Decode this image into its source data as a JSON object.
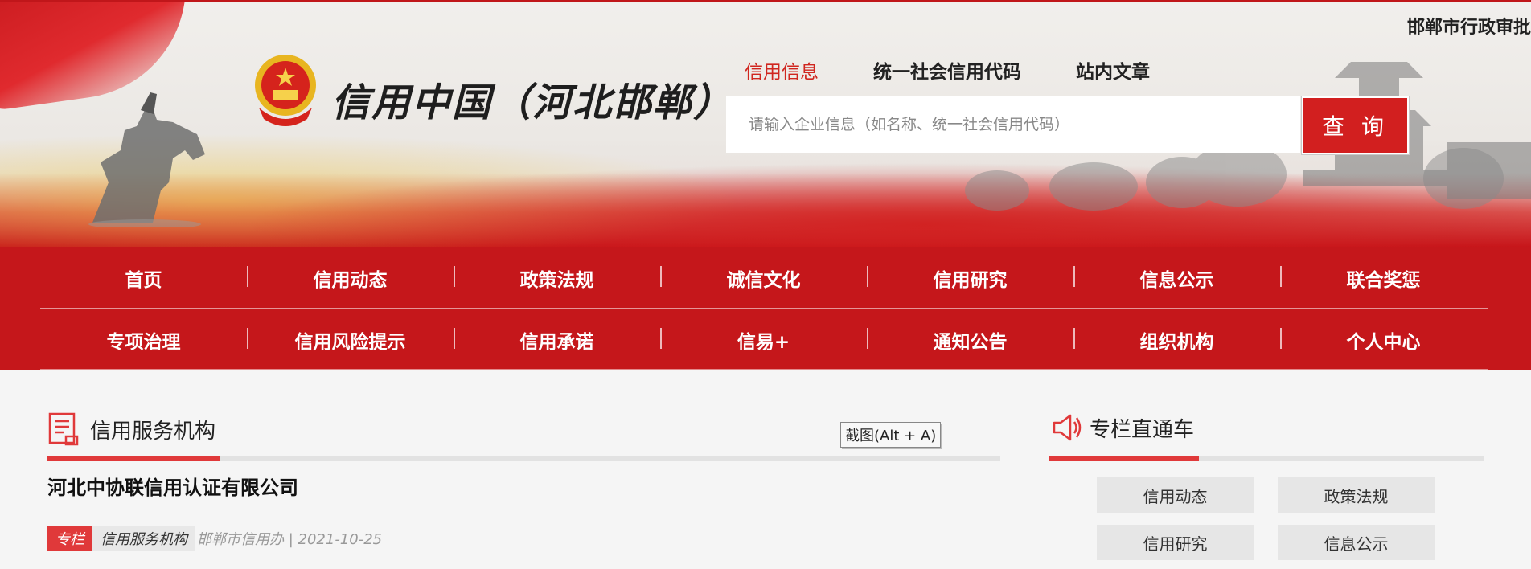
{
  "header": {
    "site_title": "信用中国（河北邯郸）",
    "city_label": "邯郸市行政审批",
    "emblem_icon": "national-emblem-icon"
  },
  "search": {
    "tabs": [
      {
        "label": "信用信息",
        "active": true
      },
      {
        "label": "统一社会信用代码",
        "active": false
      },
      {
        "label": "站内文章",
        "active": false
      }
    ],
    "placeholder": "请输入企业信息（如名称、统一社会信用代码）",
    "value": "",
    "button_label": "查 询"
  },
  "nav": {
    "row1": [
      "首页",
      "信用动态",
      "政策法规",
      "诚信文化",
      "信用研究",
      "信息公示",
      "联合奖惩"
    ],
    "row2": [
      "专项治理",
      "信用风险提示",
      "信用承诺",
      "信易+",
      "通知公告",
      "组织机构",
      "个人中心"
    ]
  },
  "main": {
    "section_title": "信用服务机构",
    "section_icon": "document-icon",
    "article": {
      "title": "河北中协联信用认证有限公司",
      "tag": "专栏",
      "category": "信用服务机构",
      "meta": "邯郸市信用办 | 2021-10-25"
    },
    "tooltip": "截图(Alt + A)"
  },
  "sidebar": {
    "title": "专栏直通车",
    "icon": "megaphone-icon",
    "buttons": [
      "信用动态",
      "政策法规",
      "信用研究",
      "信息公示"
    ]
  },
  "colors": {
    "brand_red": "#c5171b",
    "accent_red": "#e0393a",
    "active_tab": "#d0261f"
  }
}
